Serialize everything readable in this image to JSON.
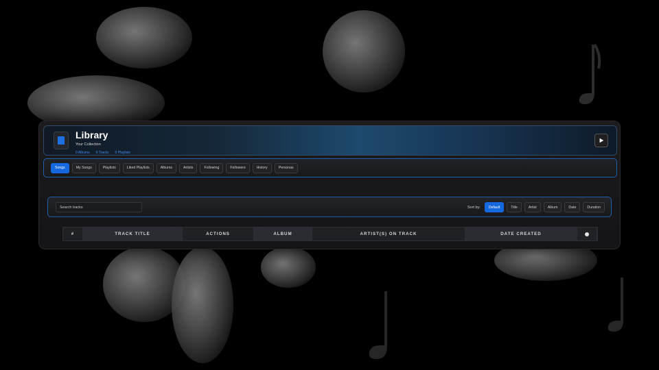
{
  "header": {
    "title": "Library",
    "subtitle": "Your Collection",
    "stats": [
      "0 Albums",
      "0 Tracks",
      "0 Playlists"
    ],
    "accent": "#1668e0"
  },
  "tabs": [
    {
      "label": "Songs",
      "active": true
    },
    {
      "label": "My Songs"
    },
    {
      "label": "Playlists"
    },
    {
      "label": "Liked Playlists"
    },
    {
      "label": "Albums"
    },
    {
      "label": "Artists"
    },
    {
      "label": "Following"
    },
    {
      "label": "Followers"
    },
    {
      "label": "History"
    },
    {
      "label": "Personas"
    }
  ],
  "search": {
    "placeholder": "Search tracks"
  },
  "sort": {
    "label": "Sort by:",
    "options": [
      {
        "label": "Default",
        "active": true
      },
      {
        "label": "Title"
      },
      {
        "label": "Artist"
      },
      {
        "label": "Album"
      },
      {
        "label": "Date"
      },
      {
        "label": "Duration"
      }
    ]
  },
  "table": {
    "columns": [
      "#",
      "TRACK TITLE",
      "ACTIONS",
      "ALBUM",
      "ARTIST(S) ON TRACK",
      "DATE CREATED"
    ],
    "info_icon": "info-icon"
  }
}
